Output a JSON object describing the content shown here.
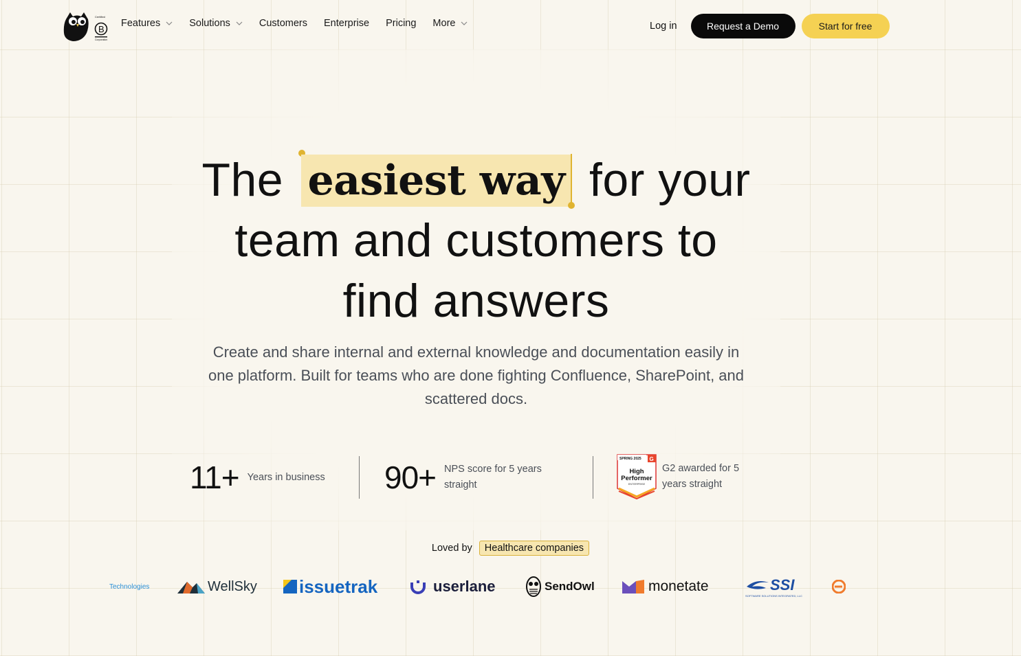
{
  "nav": {
    "items": [
      {
        "label": "Features",
        "dropdown": true
      },
      {
        "label": "Solutions",
        "dropdown": true
      },
      {
        "label": "Customers",
        "dropdown": false
      },
      {
        "label": "Enterprise",
        "dropdown": false
      },
      {
        "label": "Pricing",
        "dropdown": false
      },
      {
        "label": "More",
        "dropdown": true
      }
    ],
    "login": "Log in",
    "demo": "Request a Demo",
    "free": "Start for free",
    "bcorp_text": "Certified B Corporation"
  },
  "hero": {
    "pre": "The",
    "highlight": "easiest way",
    "post": "for your",
    "line2": "team and customers to",
    "line3": "find answers",
    "subtitle": "Create and share internal and external knowledge and documentation easily in one platform. Built for teams who are done fighting Confluence, SharePoint, and scattered docs."
  },
  "stats": [
    {
      "value": "11+",
      "label": "Years in business"
    },
    {
      "value": "90+",
      "label": "NPS score for 5 years straight"
    },
    {
      "badge": "G2 High Performer",
      "label": "G2 awarded for 5 years straight"
    }
  ],
  "g2_badge": {
    "season": "SPRING 2025",
    "line1": "High",
    "line2": "Performer",
    "segment": "ENTERPRISE"
  },
  "loved": {
    "prefix": "Loved by",
    "tag": "Healthcare companies"
  },
  "logos": [
    "Technologies",
    "WellSky",
    "issuetrak",
    "userlane",
    "SendOwl",
    "monetate",
    "SSI",
    "SOFTWARE SOLUTIONS INTEGRATED, LLC"
  ],
  "colors": {
    "accent": "#f5d153",
    "highlight": "#f7e6b0",
    "background": "#f9f6ee",
    "dark": "#0a0a0a"
  }
}
